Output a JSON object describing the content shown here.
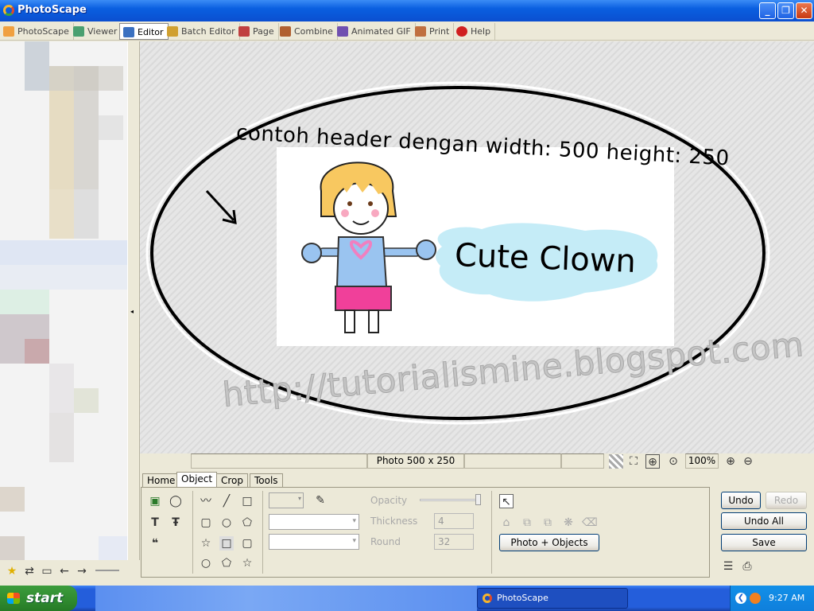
{
  "window": {
    "title": "PhotoScape"
  },
  "menu_tabs": [
    {
      "label": "PhotoScape"
    },
    {
      "label": "Viewer"
    },
    {
      "label": "Editor"
    },
    {
      "label": "Batch Editor"
    },
    {
      "label": "Page"
    },
    {
      "label": "Combine"
    },
    {
      "label": "Animated GIF"
    },
    {
      "label": "Print"
    },
    {
      "label": "Help"
    }
  ],
  "canvas": {
    "header_text": "contoh header dengan width: 500 height: 250",
    "clown_text": "Cute Clown",
    "watermark": "http://tutorialismine.blogspot.com"
  },
  "status": {
    "photo_size": "Photo 500 x 250",
    "zoom": "100%"
  },
  "bottom_tabs": [
    {
      "label": "Home"
    },
    {
      "label": "Object"
    },
    {
      "label": "Crop"
    },
    {
      "label": "Tools"
    }
  ],
  "object_panel": {
    "opacity_label": "Opacity",
    "thickness_label": "Thickness",
    "thickness_value": "4",
    "round_label": "Round",
    "round_value": "32",
    "photo_objects_label": "Photo + Objects"
  },
  "actions": {
    "undo": "Undo",
    "redo": "Redo",
    "undo_all": "Undo All",
    "save": "Save"
  },
  "taskbar": {
    "start": "start",
    "task": "PhotoScape",
    "clock": "9:27 AM"
  },
  "colors": {
    "accent": "#0a5fe0",
    "taskbar": "#245edb",
    "start": "#3c9c3c"
  }
}
